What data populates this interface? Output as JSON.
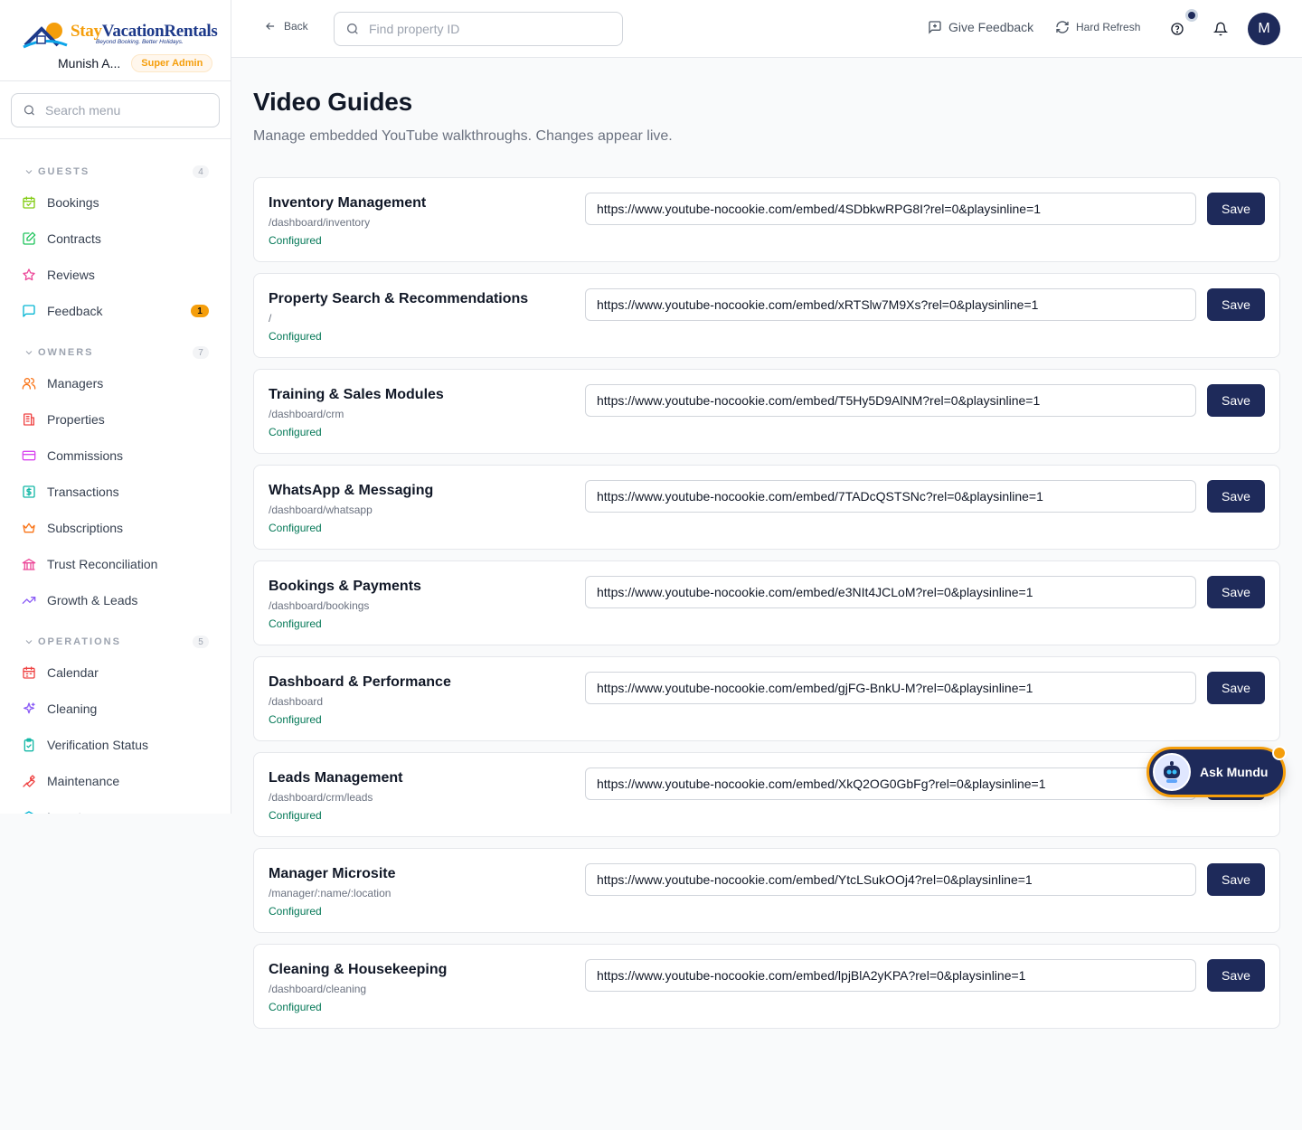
{
  "brand": {
    "name_part1": "Stay",
    "name_part2": "VacationRentals",
    "tagline": "Beyond Booking. Better Holidays.",
    "user_name": "Munish A...",
    "role": "Super Admin"
  },
  "sidebar": {
    "search_placeholder": "Search menu",
    "sections": [
      {
        "title": "GUESTS",
        "count": "4",
        "items": [
          {
            "label": "Bookings",
            "icon": "calendar-check-icon",
            "color": "#84cc16"
          },
          {
            "label": "Contracts",
            "icon": "file-edit-icon",
            "color": "#22c55e"
          },
          {
            "label": "Reviews",
            "icon": "star-icon",
            "color": "#ec4899"
          },
          {
            "label": "Feedback",
            "icon": "message-square-icon",
            "color": "#06b6d4",
            "badge": "1"
          }
        ]
      },
      {
        "title": "OWNERS",
        "count": "7",
        "items": [
          {
            "label": "Managers",
            "icon": "users-icon",
            "color": "#f97316"
          },
          {
            "label": "Properties",
            "icon": "building-icon",
            "color": "#ef4444"
          },
          {
            "label": "Commissions",
            "icon": "credit-card-icon",
            "color": "#d946ef"
          },
          {
            "label": "Transactions",
            "icon": "dollar-square-icon",
            "color": "#14b8a6"
          },
          {
            "label": "Subscriptions",
            "icon": "crown-icon",
            "color": "#f97316"
          },
          {
            "label": "Trust Reconciliation",
            "icon": "landmark-icon",
            "color": "#ec4899"
          },
          {
            "label": "Growth & Leads",
            "icon": "trending-up-icon",
            "color": "#8b5cf6"
          }
        ]
      },
      {
        "title": "OPERATIONS",
        "count": "5",
        "items": [
          {
            "label": "Calendar",
            "icon": "calendar-icon",
            "color": "#ef4444"
          },
          {
            "label": "Cleaning",
            "icon": "sparkles-icon",
            "color": "#8b5cf6"
          },
          {
            "label": "Verification Status",
            "icon": "clipboard-check-icon",
            "color": "#14b8a6"
          },
          {
            "label": "Maintenance",
            "icon": "wrench-icon",
            "color": "#ef4444"
          },
          {
            "label": "Inventory",
            "icon": "box-icon",
            "color": "#06b6d4"
          }
        ]
      }
    ]
  },
  "topbar": {
    "back_label": "Back",
    "find_placeholder": "Find property ID",
    "feedback_label": "Give Feedback",
    "refresh_label": "Hard Refresh",
    "avatar_initial": "M"
  },
  "main": {
    "title": "Video Guides",
    "subtitle": "Manage embedded YouTube walkthroughs. Changes appear live.",
    "save_label": "Save",
    "guides": [
      {
        "title": "Inventory Management",
        "path": "/dashboard/inventory",
        "status": "Configured",
        "url": "https://www.youtube-nocookie.com/embed/4SDbkwRPG8I?rel=0&playsinline=1"
      },
      {
        "title": "Property Search & Recommendations",
        "path": "/",
        "status": "Configured",
        "url": "https://www.youtube-nocookie.com/embed/xRTSlw7M9Xs?rel=0&playsinline=1"
      },
      {
        "title": "Training & Sales Modules",
        "path": "/dashboard/crm",
        "status": "Configured",
        "url": "https://www.youtube-nocookie.com/embed/T5Hy5D9AlNM?rel=0&playsinline=1"
      },
      {
        "title": "WhatsApp & Messaging",
        "path": "/dashboard/whatsapp",
        "status": "Configured",
        "url": "https://www.youtube-nocookie.com/embed/7TADcQSTSNc?rel=0&playsinline=1"
      },
      {
        "title": "Bookings & Payments",
        "path": "/dashboard/bookings",
        "status": "Configured",
        "url": "https://www.youtube-nocookie.com/embed/e3NIt4JCLoM?rel=0&playsinline=1"
      },
      {
        "title": "Dashboard & Performance",
        "path": "/dashboard",
        "status": "Configured",
        "url": "https://www.youtube-nocookie.com/embed/gjFG-BnkU-M?rel=0&playsinline=1"
      },
      {
        "title": "Leads Management",
        "path": "/dashboard/crm/leads",
        "status": "Configured",
        "url": "https://www.youtube-nocookie.com/embed/XkQ2OG0GbFg?rel=0&playsinline=1"
      },
      {
        "title": "Manager Microsite",
        "path": "/manager/:name/:location",
        "status": "Configured",
        "url": "https://www.youtube-nocookie.com/embed/YtcLSukOOj4?rel=0&playsinline=1"
      },
      {
        "title": "Cleaning & Housekeeping",
        "path": "/dashboard/cleaning",
        "status": "Configured",
        "url": "https://www.youtube-nocookie.com/embed/lpjBlA2yKPA?rel=0&playsinline=1"
      }
    ]
  },
  "assistant": {
    "label": "Ask Mundu"
  },
  "colors": {
    "primary": "#1e2a5a",
    "accent": "#f59e0b",
    "success": "#047857"
  }
}
